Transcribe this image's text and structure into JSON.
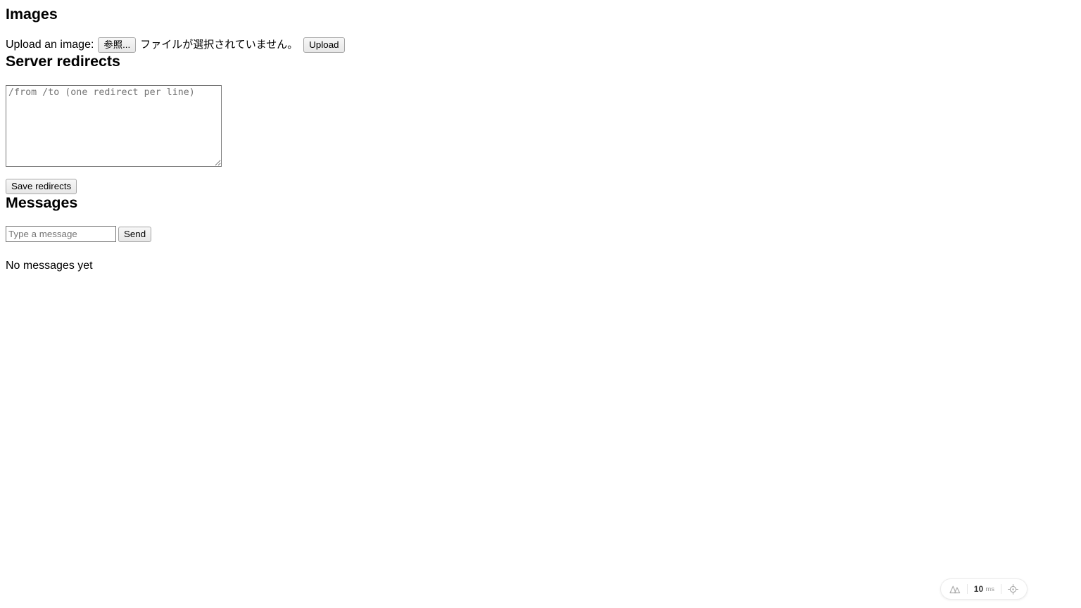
{
  "images": {
    "heading": "Images",
    "upload_label": "Upload an image:",
    "file_browse_label": "参照...",
    "file_status": "ファイルが選択されていません。",
    "upload_button": "Upload"
  },
  "redirects": {
    "heading": "Server redirects",
    "textarea_placeholder": "/from /to (one redirect per line)",
    "textarea_value": "",
    "save_button": "Save redirects"
  },
  "messages": {
    "heading": "Messages",
    "input_placeholder": "Type a message",
    "input_value": "",
    "send_button": "Send",
    "empty_state": "No messages yet"
  },
  "devtools": {
    "logo_icon": "nextjs-logo-icon",
    "time_value": "10",
    "time_unit": "ms",
    "inspector_icon": "crosshair-icon"
  },
  "colors": {
    "page_background": "#ffffff",
    "text": "#000000",
    "placeholder": "#757575",
    "input_border": "#767676",
    "badge_border": "#ebebeb",
    "badge_text": "#3c3c3c",
    "badge_unit_text": "#9a9a9a"
  }
}
